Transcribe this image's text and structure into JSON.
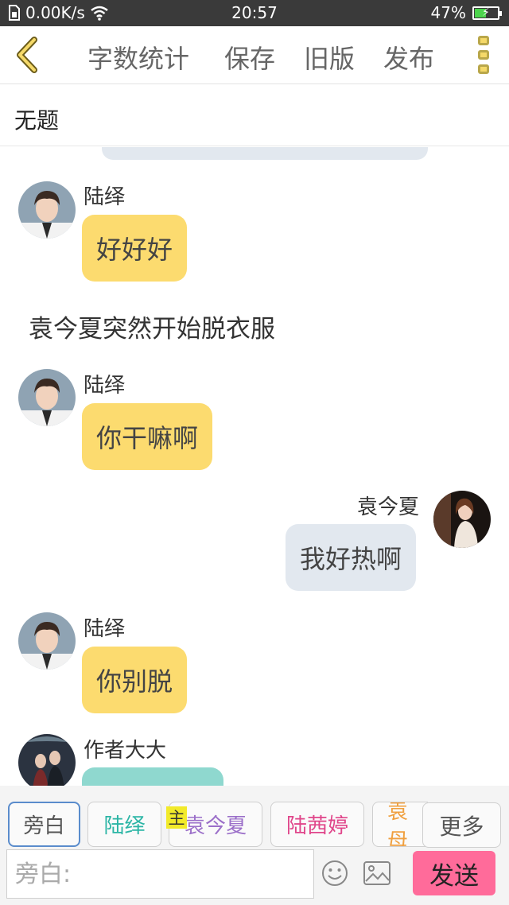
{
  "status_bar": {
    "network_speed": "0.00K/s",
    "time": "20:57",
    "battery": "47%",
    "battery_level": 0.47
  },
  "toolbar": {
    "word_count": "字数统计",
    "save": "保存",
    "old_version": "旧版",
    "publish": "发布"
  },
  "title": "无题",
  "chat": {
    "m1": {
      "name": "陆绎",
      "text": "好好好"
    },
    "narration": "袁今夏突然开始脱衣服",
    "m2": {
      "name": "陆绎",
      "text": "你干嘛啊"
    },
    "m3": {
      "name": "袁今夏",
      "text": "我好热啊"
    },
    "m4": {
      "name": "陆绎",
      "text": "你别脱"
    },
    "m5": {
      "name": "作者大大",
      "text": ""
    }
  },
  "characters": {
    "narrator": "旁白",
    "c1": "陆绎",
    "c2": "袁今夏",
    "c3": "陆茜婷",
    "c4": "袁母",
    "main_badge": "主",
    "more": "更多"
  },
  "colors": {
    "narrator": "#555555",
    "c1": "#2bb5a5",
    "c2": "#9b6fc9",
    "c3": "#e0458a",
    "c4": "#f0a040",
    "send": "#ff6b9a",
    "bubble_lu": "#fcdb6f",
    "bubble_yuan": "#e2e8ef",
    "bubble_author": "#8fd8cf"
  },
  "input": {
    "placeholder": "旁白:"
  },
  "send_label": "发送"
}
